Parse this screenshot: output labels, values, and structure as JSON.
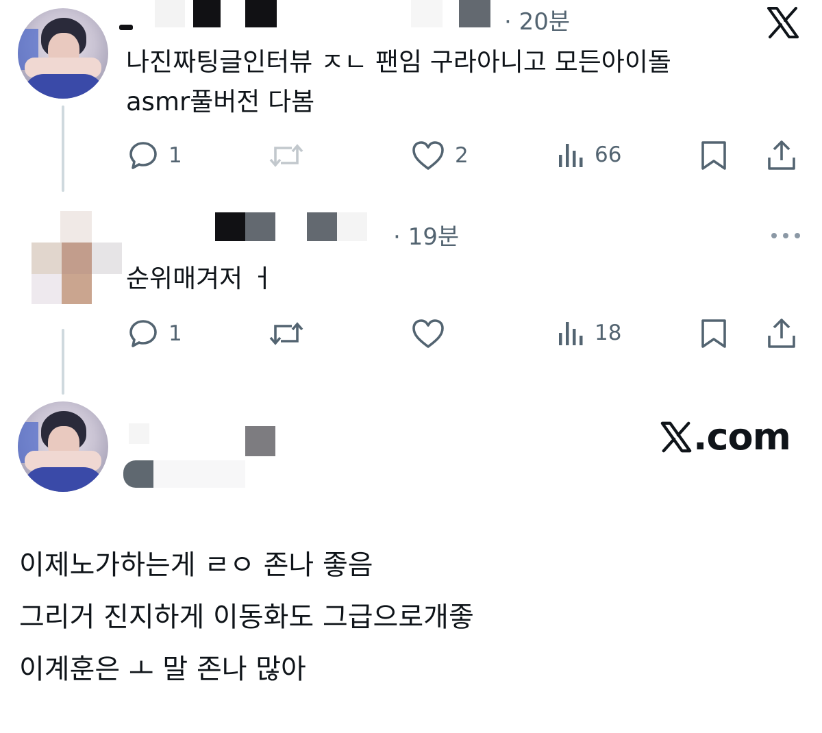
{
  "tweet1": {
    "time": "· 20분",
    "text_line1": "나진짜팅글인터뷰 ㅈㄴ 팬임 구라아니고 모든아이돌",
    "text_line2": "asmr풀버전 다봄",
    "reply_count": "1",
    "like_count": "2",
    "view_count": "66"
  },
  "tweet2": {
    "time": "· 19분",
    "text": "순위매겨저 ㅓ",
    "reply_count": "1",
    "view_count": "18"
  },
  "tweet3": {
    "site_label": ".com",
    "lines": [
      "이제노가하는게 ㄹㅇ 존나 좋음",
      "그리거 진지하게 이동화도 그급으로개좋",
      "이계훈은 ㅗ 말 존나 많아"
    ]
  },
  "colors": {
    "text": "#0f1419",
    "muted": "#536471",
    "thread_line": "#cfd9de",
    "redaction_dark": "#111114",
    "redaction_gray": "#636970"
  },
  "icons": {
    "reply": "reply-icon",
    "retweet": "retweet-icon",
    "like": "heart-icon",
    "views": "views-icon",
    "bookmark": "bookmark-icon",
    "share": "share-icon",
    "logo": "x-logo-icon",
    "more": "more-icon"
  }
}
